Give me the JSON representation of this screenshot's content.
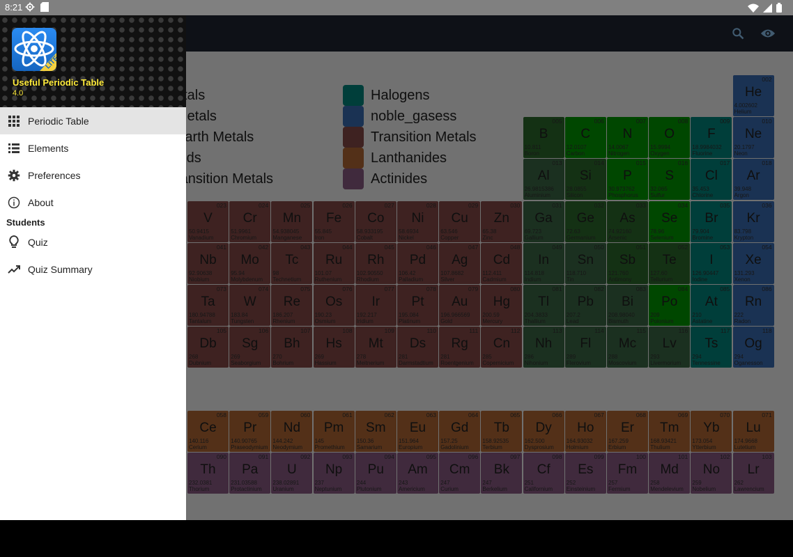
{
  "status_bar": {
    "time": "8:21",
    "left_icons": [
      "settings-icon",
      "sd-card-icon"
    ],
    "right_icons": [
      "wifi-icon",
      "signal-icon",
      "battery-icon"
    ]
  },
  "toolbar": {
    "actions": [
      "search-icon",
      "eye-icon"
    ]
  },
  "drawer": {
    "app_name": "Useful Periodic Table",
    "version": "4.0",
    "logo_badge": "LITE",
    "items": [
      {
        "label": "Periodic Table",
        "icon": "grid-icon",
        "active": true
      },
      {
        "label": "Elements",
        "icon": "list-icon",
        "active": false
      },
      {
        "label": "Preferences",
        "icon": "gear-icon",
        "active": false
      },
      {
        "label": "About",
        "icon": "info-icon",
        "active": false
      }
    ],
    "section_label": "Students",
    "student_items": [
      {
        "label": "Quiz",
        "icon": "lightbulb-icon"
      },
      {
        "label": "Quiz Summary",
        "icon": "trending-icon"
      }
    ]
  },
  "legend": {
    "left": [
      "etals",
      "Metals",
      "Earth Metals",
      "oids",
      "ransition Metals"
    ],
    "right": [
      {
        "label": "Halogens",
        "color": "#008a80"
      },
      {
        "label": "noble_gasess",
        "color": "#3b6fb8"
      },
      {
        "label": "Transition Metals",
        "color": "#8a4c4a"
      },
      {
        "label": "Lanthanides",
        "color": "#b86a36"
      },
      {
        "label": "Actinides",
        "color": "#8e5e88"
      }
    ]
  },
  "colors": {
    "post": "#3d6a47",
    "nonmetal": "#009e00",
    "metalloid": "#2e6e2e",
    "halogen": "#008a80",
    "noble": "#3b6fb8",
    "transition": "#8a4c4a",
    "lanthanide": "#b86a36",
    "actinide": "#8e5e88",
    "unknown_nonmetal": "#2e6e2e"
  },
  "elements": [
    {
      "num": "002",
      "sym": "He",
      "mass": "4.002602",
      "name": "Helium",
      "cat": "noble",
      "col": 13,
      "row": 0
    },
    {
      "num": "005",
      "sym": "B",
      "mass": "10.811",
      "name": "Boron",
      "cat": "metalloid",
      "col": 8,
      "row": 1
    },
    {
      "num": "006",
      "sym": "C",
      "mass": "12.0107",
      "name": "Carbon",
      "cat": "nonmetal",
      "col": 9,
      "row": 1
    },
    {
      "num": "007",
      "sym": "N",
      "mass": "14.0067",
      "name": "Nitrogen",
      "cat": "nonmetal",
      "col": 10,
      "row": 1
    },
    {
      "num": "008",
      "sym": "O",
      "mass": "15.9994",
      "name": "Oxygen",
      "cat": "nonmetal",
      "col": 11,
      "row": 1
    },
    {
      "num": "009",
      "sym": "F",
      "mass": "18.9984032",
      "name": "Fluorine",
      "cat": "halogen",
      "col": 12,
      "row": 1
    },
    {
      "num": "010",
      "sym": "Ne",
      "mass": "20.1797",
      "name": "Neon",
      "cat": "noble",
      "col": 13,
      "row": 1
    },
    {
      "num": "013",
      "sym": "Al",
      "mass": "26.9815386",
      "name": "Aluminium",
      "cat": "post",
      "col": 8,
      "row": 2
    },
    {
      "num": "014",
      "sym": "Si",
      "mass": "28.0855",
      "name": "Silicon",
      "cat": "metalloid",
      "col": 9,
      "row": 2
    },
    {
      "num": "015",
      "sym": "P",
      "mass": "30.973762",
      "name": "Phosphorus",
      "cat": "nonmetal",
      "col": 10,
      "row": 2
    },
    {
      "num": "016",
      "sym": "S",
      "mass": "32.065",
      "name": "Sulfur",
      "cat": "nonmetal",
      "col": 11,
      "row": 2
    },
    {
      "num": "017",
      "sym": "Cl",
      "mass": "35.453",
      "name": "Chlorine",
      "cat": "halogen",
      "col": 12,
      "row": 2
    },
    {
      "num": "018",
      "sym": "Ar",
      "mass": "39.948",
      "name": "Argon",
      "cat": "noble",
      "col": 13,
      "row": 2
    },
    {
      "num": "023",
      "sym": "V",
      "mass": "50.9415",
      "name": "Vanadium",
      "cat": "transition",
      "col": 0,
      "row": 3
    },
    {
      "num": "024",
      "sym": "Cr",
      "mass": "51.9961",
      "name": "Chromium",
      "cat": "transition",
      "col": 1,
      "row": 3
    },
    {
      "num": "025",
      "sym": "Mn",
      "mass": "54.938045",
      "name": "Manganese",
      "cat": "transition",
      "col": 2,
      "row": 3
    },
    {
      "num": "026",
      "sym": "Fe",
      "mass": "55.845",
      "name": "Iron",
      "cat": "transition",
      "col": 3,
      "row": 3
    },
    {
      "num": "027",
      "sym": "Co",
      "mass": "58.933195",
      "name": "Cobalt",
      "cat": "transition",
      "col": 4,
      "row": 3
    },
    {
      "num": "028",
      "sym": "Ni",
      "mass": "58.6934",
      "name": "Nickel",
      "cat": "transition",
      "col": 5,
      "row": 3
    },
    {
      "num": "029",
      "sym": "Cu",
      "mass": "63.546",
      "name": "Copper",
      "cat": "transition",
      "col": 6,
      "row": 3
    },
    {
      "num": "030",
      "sym": "Zn",
      "mass": "65.38",
      "name": "Zinc",
      "cat": "transition",
      "col": 7,
      "row": 3
    },
    {
      "num": "031",
      "sym": "Ga",
      "mass": "69.723",
      "name": "Gallium",
      "cat": "post",
      "col": 8,
      "row": 3
    },
    {
      "num": "032",
      "sym": "Ge",
      "mass": "72.63",
      "name": "Germanium",
      "cat": "metalloid",
      "col": 9,
      "row": 3
    },
    {
      "num": "033",
      "sym": "As",
      "mass": "74.92160",
      "name": "Arsenic",
      "cat": "metalloid",
      "col": 10,
      "row": 3
    },
    {
      "num": "034",
      "sym": "Se",
      "mass": "78.96",
      "name": "Selenium",
      "cat": "nonmetal",
      "col": 11,
      "row": 3
    },
    {
      "num": "035",
      "sym": "Br",
      "mass": "79.904",
      "name": "Bromine",
      "cat": "halogen",
      "col": 12,
      "row": 3
    },
    {
      "num": "036",
      "sym": "Kr",
      "mass": "83.798",
      "name": "Krypton",
      "cat": "noble",
      "col": 13,
      "row": 3
    },
    {
      "num": "041",
      "sym": "Nb",
      "mass": "92.90638",
      "name": "Niobium",
      "cat": "transition",
      "col": 0,
      "row": 4
    },
    {
      "num": "042",
      "sym": "Mo",
      "mass": "95.94",
      "name": "Molybdenum",
      "cat": "transition",
      "col": 1,
      "row": 4
    },
    {
      "num": "043",
      "sym": "Tc",
      "mass": "98",
      "name": "Technetium",
      "cat": "transition",
      "col": 2,
      "row": 4
    },
    {
      "num": "044",
      "sym": "Ru",
      "mass": "101.07",
      "name": "Ruthenium",
      "cat": "transition",
      "col": 3,
      "row": 4
    },
    {
      "num": "045",
      "sym": "Rh",
      "mass": "102.90550",
      "name": "Rhodium",
      "cat": "transition",
      "col": 4,
      "row": 4
    },
    {
      "num": "046",
      "sym": "Pd",
      "mass": "106.42",
      "name": "Palladium",
      "cat": "transition",
      "col": 5,
      "row": 4
    },
    {
      "num": "047",
      "sym": "Ag",
      "mass": "107.8682",
      "name": "Silver",
      "cat": "transition",
      "col": 6,
      "row": 4
    },
    {
      "num": "048",
      "sym": "Cd",
      "mass": "112.411",
      "name": "Cadmium",
      "cat": "transition",
      "col": 7,
      "row": 4
    },
    {
      "num": "049",
      "sym": "In",
      "mass": "114.818",
      "name": "Indium",
      "cat": "post",
      "col": 8,
      "row": 4
    },
    {
      "num": "050",
      "sym": "Sn",
      "mass": "118.710",
      "name": "Tin",
      "cat": "post",
      "col": 9,
      "row": 4
    },
    {
      "num": "051",
      "sym": "Sb",
      "mass": "121.760",
      "name": "Antimony",
      "cat": "metalloid",
      "col": 10,
      "row": 4
    },
    {
      "num": "052",
      "sym": "Te",
      "mass": "127.60",
      "name": "Tellurium",
      "cat": "metalloid",
      "col": 11,
      "row": 4
    },
    {
      "num": "053",
      "sym": "I",
      "mass": "126.90447",
      "name": "Iodine",
      "cat": "halogen",
      "col": 12,
      "row": 4
    },
    {
      "num": "054",
      "sym": "Xe",
      "mass": "131.293",
      "name": "Xenon",
      "cat": "noble",
      "col": 13,
      "row": 4
    },
    {
      "num": "073",
      "sym": "Ta",
      "mass": "180.94788",
      "name": "Tantalum",
      "cat": "transition",
      "col": 0,
      "row": 5
    },
    {
      "num": "074",
      "sym": "W",
      "mass": "183.84",
      "name": "Tungsten",
      "cat": "transition",
      "col": 1,
      "row": 5
    },
    {
      "num": "075",
      "sym": "Re",
      "mass": "186.207",
      "name": "Rhenium",
      "cat": "transition",
      "col": 2,
      "row": 5
    },
    {
      "num": "076",
      "sym": "Os",
      "mass": "190.23",
      "name": "Osmium",
      "cat": "transition",
      "col": 3,
      "row": 5
    },
    {
      "num": "077",
      "sym": "Ir",
      "mass": "192.217",
      "name": "Iridium",
      "cat": "transition",
      "col": 4,
      "row": 5
    },
    {
      "num": "078",
      "sym": "Pt",
      "mass": "195.084",
      "name": "Platinum",
      "cat": "transition",
      "col": 5,
      "row": 5
    },
    {
      "num": "079",
      "sym": "Au",
      "mass": "196.966569",
      "name": "Gold",
      "cat": "transition",
      "col": 6,
      "row": 5
    },
    {
      "num": "080",
      "sym": "Hg",
      "mass": "200.59",
      "name": "Mercury",
      "cat": "transition",
      "col": 7,
      "row": 5
    },
    {
      "num": "081",
      "sym": "Tl",
      "mass": "204.3833",
      "name": "Thallium",
      "cat": "post",
      "col": 8,
      "row": 5
    },
    {
      "num": "082",
      "sym": "Pb",
      "mass": "207.2",
      "name": "Lead",
      "cat": "post",
      "col": 9,
      "row": 5
    },
    {
      "num": "083",
      "sym": "Bi",
      "mass": "208.98040",
      "name": "Bismuth",
      "cat": "post",
      "col": 10,
      "row": 5
    },
    {
      "num": "084",
      "sym": "Po",
      "mass": "209",
      "name": "Polonium",
      "cat": "nonmetal",
      "col": 11,
      "row": 5
    },
    {
      "num": "085",
      "sym": "At",
      "mass": "210",
      "name": "Astatine",
      "cat": "halogen",
      "col": 12,
      "row": 5
    },
    {
      "num": "086",
      "sym": "Rn",
      "mass": "222",
      "name": "Radon",
      "cat": "noble",
      "col": 13,
      "row": 5
    },
    {
      "num": "105",
      "sym": "Db",
      "mass": "268",
      "name": "Dubnium",
      "cat": "transition",
      "col": 0,
      "row": 6
    },
    {
      "num": "106",
      "sym": "Sg",
      "mass": "269",
      "name": "Seaborgium",
      "cat": "transition",
      "col": 1,
      "row": 6
    },
    {
      "num": "107",
      "sym": "Bh",
      "mass": "270",
      "name": "Bohrium",
      "cat": "transition",
      "col": 2,
      "row": 6
    },
    {
      "num": "108",
      "sym": "Hs",
      "mass": "269",
      "name": "Hassium",
      "cat": "transition",
      "col": 3,
      "row": 6
    },
    {
      "num": "109",
      "sym": "Mt",
      "mass": "278",
      "name": "Meitnerium",
      "cat": "transition",
      "col": 4,
      "row": 6
    },
    {
      "num": "110",
      "sym": "Ds",
      "mass": "281",
      "name": "Darmstadtium",
      "cat": "transition",
      "col": 5,
      "row": 6
    },
    {
      "num": "111",
      "sym": "Rg",
      "mass": "281",
      "name": "Roentgenium",
      "cat": "transition",
      "col": 6,
      "row": 6
    },
    {
      "num": "112",
      "sym": "Cn",
      "mass": "285",
      "name": "Copernicium",
      "cat": "transition",
      "col": 7,
      "row": 6
    },
    {
      "num": "113",
      "sym": "Nh",
      "mass": "286",
      "name": "Nihonium",
      "cat": "post",
      "col": 8,
      "row": 6
    },
    {
      "num": "114",
      "sym": "Fl",
      "mass": "289",
      "name": "Flerovium",
      "cat": "post",
      "col": 9,
      "row": 6
    },
    {
      "num": "115",
      "sym": "Mc",
      "mass": "288",
      "name": "Moscovium",
      "cat": "post",
      "col": 10,
      "row": 6
    },
    {
      "num": "116",
      "sym": "Lv",
      "mass": "293",
      "name": "Livermorium",
      "cat": "post",
      "col": 11,
      "row": 6
    },
    {
      "num": "117",
      "sym": "Ts",
      "mass": "294",
      "name": "Tennessine",
      "cat": "halogen",
      "col": 12,
      "row": 6
    },
    {
      "num": "118",
      "sym": "Og",
      "mass": "294",
      "name": "Oganesson",
      "cat": "noble",
      "col": 13,
      "row": 6
    },
    {
      "num": "058",
      "sym": "Ce",
      "mass": "140.116",
      "name": "Cerium",
      "cat": "lanthanide",
      "col": 0,
      "row": 8
    },
    {
      "num": "059",
      "sym": "Pr",
      "mass": "140.90765",
      "name": "Praseodymium",
      "cat": "lanthanide",
      "col": 1,
      "row": 8
    },
    {
      "num": "060",
      "sym": "Nd",
      "mass": "144.242",
      "name": "Neodymium",
      "cat": "lanthanide",
      "col": 2,
      "row": 8
    },
    {
      "num": "061",
      "sym": "Pm",
      "mass": "145",
      "name": "Promethium",
      "cat": "lanthanide",
      "col": 3,
      "row": 8
    },
    {
      "num": "062",
      "sym": "Sm",
      "mass": "150.36",
      "name": "Samarium",
      "cat": "lanthanide",
      "col": 4,
      "row": 8
    },
    {
      "num": "063",
      "sym": "Eu",
      "mass": "151.964",
      "name": "Europium",
      "cat": "lanthanide",
      "col": 5,
      "row": 8
    },
    {
      "num": "064",
      "sym": "Gd",
      "mass": "157.25",
      "name": "Gadolinium",
      "cat": "lanthanide",
      "col": 6,
      "row": 8
    },
    {
      "num": "065",
      "sym": "Tb",
      "mass": "158.92535",
      "name": "Terbium",
      "cat": "lanthanide",
      "col": 7,
      "row": 8
    },
    {
      "num": "066",
      "sym": "Dy",
      "mass": "162.500",
      "name": "Dysprosium",
      "cat": "lanthanide",
      "col": 8,
      "row": 8
    },
    {
      "num": "067",
      "sym": "Ho",
      "mass": "164.93032",
      "name": "Holmium",
      "cat": "lanthanide",
      "col": 9,
      "row": 8
    },
    {
      "num": "068",
      "sym": "Er",
      "mass": "167.259",
      "name": "Erbium",
      "cat": "lanthanide",
      "col": 10,
      "row": 8
    },
    {
      "num": "069",
      "sym": "Tm",
      "mass": "168.93421",
      "name": "Thulium",
      "cat": "lanthanide",
      "col": 11,
      "row": 8
    },
    {
      "num": "070",
      "sym": "Yb",
      "mass": "173.054",
      "name": "Ytterbium",
      "cat": "lanthanide",
      "col": 12,
      "row": 8
    },
    {
      "num": "071",
      "sym": "Lu",
      "mass": "174.9668",
      "name": "Lutetium",
      "cat": "lanthanide",
      "col": 13,
      "row": 8
    },
    {
      "num": "090",
      "sym": "Th",
      "mass": "232.0381",
      "name": "Thorium",
      "cat": "actinide",
      "col": 0,
      "row": 9
    },
    {
      "num": "091",
      "sym": "Pa",
      "mass": "231.03588",
      "name": "Protactinium",
      "cat": "actinide",
      "col": 1,
      "row": 9
    },
    {
      "num": "092",
      "sym": "U",
      "mass": "238.02891",
      "name": "Uranium",
      "cat": "actinide",
      "col": 2,
      "row": 9
    },
    {
      "num": "093",
      "sym": "Np",
      "mass": "237",
      "name": "Neptunium",
      "cat": "actinide",
      "col": 3,
      "row": 9
    },
    {
      "num": "094",
      "sym": "Pu",
      "mass": "244",
      "name": "Plutonium",
      "cat": "actinide",
      "col": 4,
      "row": 9
    },
    {
      "num": "095",
      "sym": "Am",
      "mass": "243",
      "name": "Americium",
      "cat": "actinide",
      "col": 5,
      "row": 9
    },
    {
      "num": "096",
      "sym": "Cm",
      "mass": "247",
      "name": "Curium",
      "cat": "actinide",
      "col": 6,
      "row": 9
    },
    {
      "num": "097",
      "sym": "Bk",
      "mass": "247",
      "name": "Berkelium",
      "cat": "actinide",
      "col": 7,
      "row": 9
    },
    {
      "num": "098",
      "sym": "Cf",
      "mass": "251",
      "name": "Californium",
      "cat": "actinide",
      "col": 8,
      "row": 9
    },
    {
      "num": "099",
      "sym": "Es",
      "mass": "252",
      "name": "Einsteinium",
      "cat": "actinide",
      "col": 9,
      "row": 9
    },
    {
      "num": "100",
      "sym": "Fm",
      "mass": "257",
      "name": "Fermium",
      "cat": "actinide",
      "col": 10,
      "row": 9
    },
    {
      "num": "101",
      "sym": "Md",
      "mass": "258",
      "name": "Mendelevium",
      "cat": "actinide",
      "col": 11,
      "row": 9
    },
    {
      "num": "102",
      "sym": "No",
      "mass": "259",
      "name": "Nobelium",
      "cat": "actinide",
      "col": 12,
      "row": 9
    },
    {
      "num": "103",
      "sym": "Lr",
      "mass": "262",
      "name": "Lawrencium",
      "cat": "actinide",
      "col": 13,
      "row": 9
    }
  ]
}
